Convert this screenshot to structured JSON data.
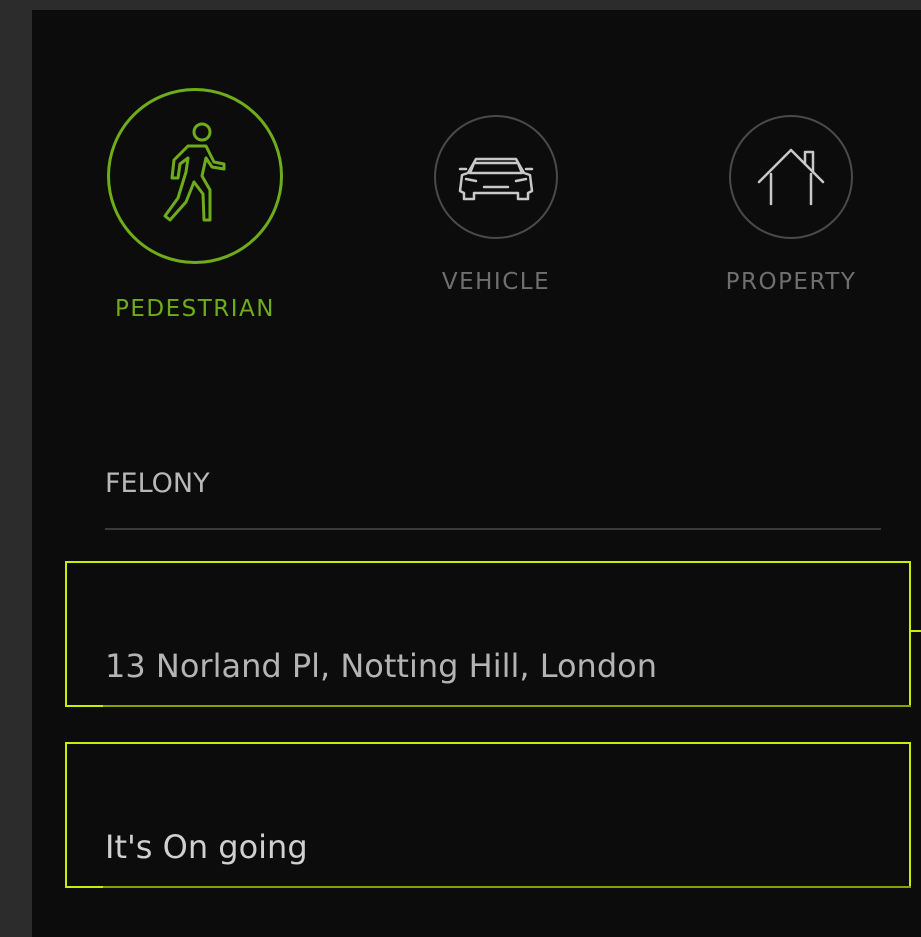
{
  "categories": [
    {
      "id": "pedestrian",
      "label": "PEDESTRIAN",
      "icon": "pedestrian-icon",
      "selected": true
    },
    {
      "id": "vehicle",
      "label": "VEHICLE",
      "icon": "car-icon",
      "selected": false
    },
    {
      "id": "property",
      "label": "PROPERTY",
      "icon": "house-icon",
      "selected": false
    }
  ],
  "crime_type": {
    "value": "FELONY"
  },
  "location": {
    "value": "13 Norland Pl, Notting Hill, London"
  },
  "status": {
    "value": "It's On going"
  },
  "colors": {
    "accent": "#6fac1c",
    "focus_outline": "#c6f000",
    "background": "#0c0c0c",
    "muted_text": "#6f6f6f"
  }
}
